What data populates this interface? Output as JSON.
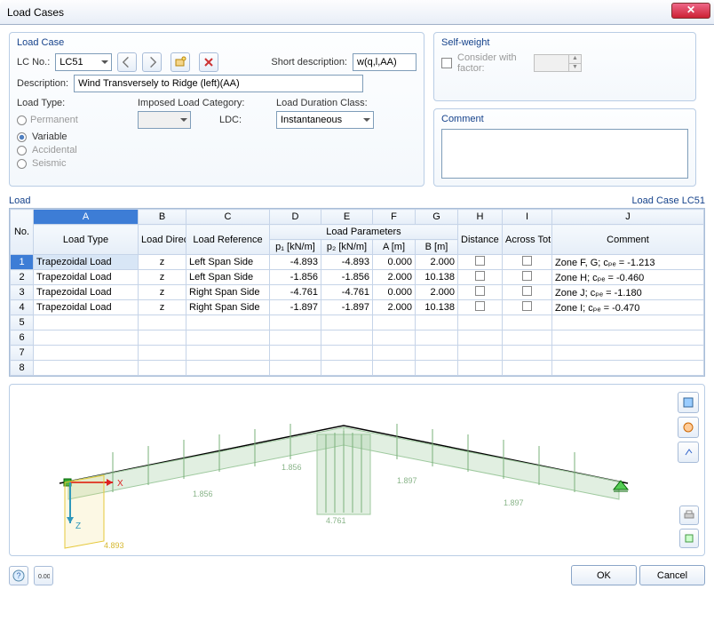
{
  "window": {
    "title": "Load Cases"
  },
  "loadcase": {
    "title": "Load Case",
    "lcno_label": "LC No.:",
    "lcno_value": "LC51",
    "shortdesc_label": "Short description:",
    "shortdesc_value": "w(q,l,AA)",
    "desc_label": "Description:",
    "desc_value": "Wind Transversely to Ridge (left)(AA)",
    "loadtype_label": "Load Type:",
    "imposed_label": "Imposed Load Category:",
    "ldc_label": "Load Duration Class:",
    "ldc_short": "LDC:",
    "ldc_value": "Instantaneous",
    "lt_permanent": "Permanent",
    "lt_variable": "Variable",
    "lt_accidental": "Accidental",
    "lt_seismic": "Seismic"
  },
  "selfweight": {
    "title": "Self-weight",
    "consider_label": "Consider with factor:"
  },
  "commentbox": {
    "title": "Comment",
    "value": ""
  },
  "load": {
    "title": "Load",
    "case_label": "Load Case LC51",
    "letters": [
      "A",
      "B",
      "C",
      "D",
      "E",
      "F",
      "G",
      "H",
      "I",
      "J"
    ],
    "hdr_no": "No.",
    "hdr_loadtype": "Load Type",
    "hdr_loaddir": "Load Direction",
    "hdr_loadref": "Load Reference",
    "hdr_loadparams": "Load Parameters",
    "hdr_p1": "p₁ [kN/m]",
    "hdr_p2": "p₂ [kN/m]",
    "hdr_A": "A [m]",
    "hdr_B": "B [m]",
    "hdr_dist": "Distance in %",
    "hdr_across": "Across Tot Length",
    "hdr_comment": "Comment",
    "rows": [
      {
        "n": "1",
        "type": "Trapezoidal Load",
        "dir": "z",
        "ref": "Left Span Side",
        "p1": "-4.893",
        "p2": "-4.893",
        "A": "0.000",
        "B": "2.000",
        "comment": "Zone F, G; cₚₑ = -1.213"
      },
      {
        "n": "2",
        "type": "Trapezoidal Load",
        "dir": "z",
        "ref": "Left Span Side",
        "p1": "-1.856",
        "p2": "-1.856",
        "A": "2.000",
        "B": "10.138",
        "comment": "Zone H; cₚₑ = -0.460"
      },
      {
        "n": "3",
        "type": "Trapezoidal Load",
        "dir": "z",
        "ref": "Right Span Side",
        "p1": "-4.761",
        "p2": "-4.761",
        "A": "0.000",
        "B": "2.000",
        "comment": "Zone J; cₚₑ = -1.180"
      },
      {
        "n": "4",
        "type": "Trapezoidal Load",
        "dir": "z",
        "ref": "Right Span Side",
        "p1": "-1.897",
        "p2": "-1.897",
        "A": "2.000",
        "B": "10.138",
        "comment": "Zone I; cₚₑ = -0.470"
      }
    ],
    "empty_rows": [
      "5",
      "6",
      "7",
      "8"
    ]
  },
  "preview": {
    "x_label": "X",
    "z_label": "Z",
    "vals": {
      "a": "1.856",
      "b": "4.893",
      "c": "1.856",
      "d": "4.761",
      "e": "1.897",
      "f": "1.897",
      "g": "1.856"
    }
  },
  "footer": {
    "ok": "OK",
    "cancel": "Cancel"
  }
}
